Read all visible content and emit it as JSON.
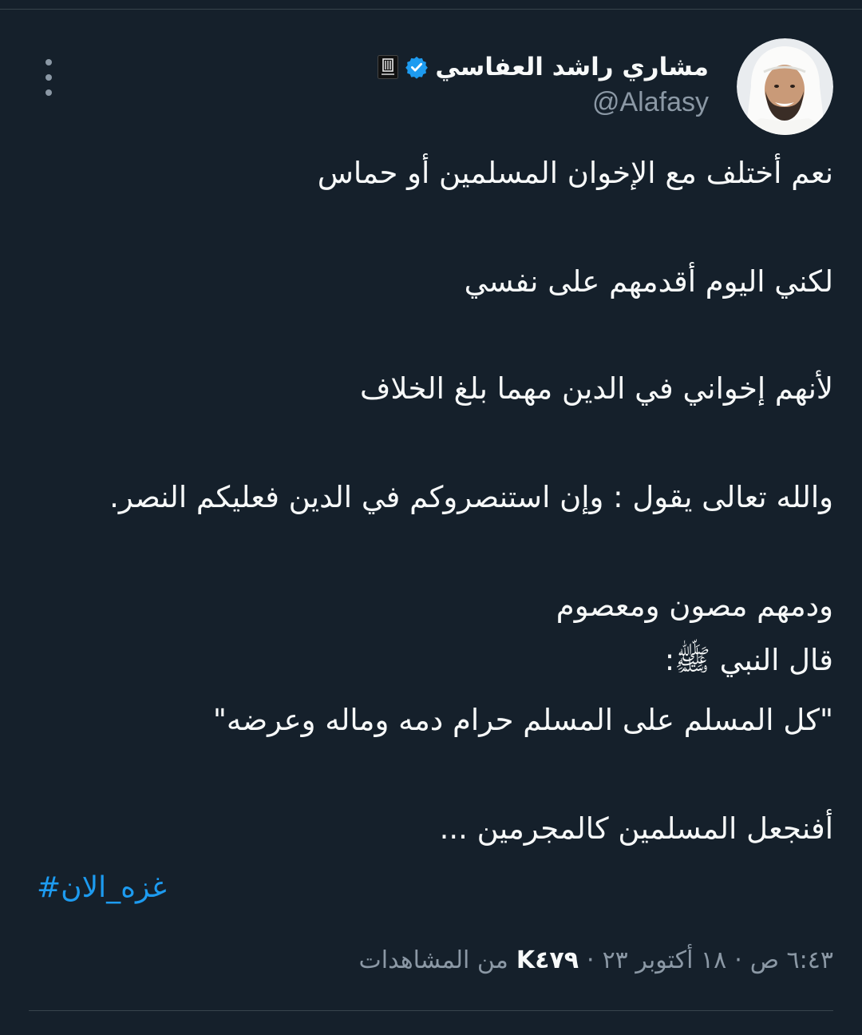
{
  "author": {
    "name": "مشاري راشد العفاسي",
    "handle": "@Alafasy",
    "verified": true,
    "badge_color": "#1d9bf0"
  },
  "tweet": {
    "lines": [
      "نعم أختلف مع الإخوان المسلمين أو حماس",
      "لكني اليوم أقدمهم على نفسي",
      "لأنهم إخواني في الدين مهما بلغ الخلاف",
      "والله تعالى يقول : وإن استنصروكم في الدين فعليكم النصر.",
      "ودمهم مصون ومعصوم",
      "قال النبي ﷺ:",
      "\"كل المسلم على المسلم حرام دمه وماله وعرضه\"",
      "أفنجعل المسلمين كالمجرمين ..."
    ],
    "hashtag": "#غزه_الان"
  },
  "meta": {
    "time": "٦:٤٣ ص",
    "date": "١٨ أكتوبر ٢٣",
    "views_count": "K٤٧٩",
    "views_label": "من المشاهدات",
    "separator": "·"
  },
  "colors": {
    "background": "#15202b",
    "text": "#f7f9f9",
    "muted": "#8b98a5",
    "link": "#1d9bf0",
    "divider": "#38444d"
  },
  "icons": {
    "more": "more-vertical-icon",
    "verified": "verified-badge-icon",
    "affiliation": "affiliation-logo-icon"
  }
}
